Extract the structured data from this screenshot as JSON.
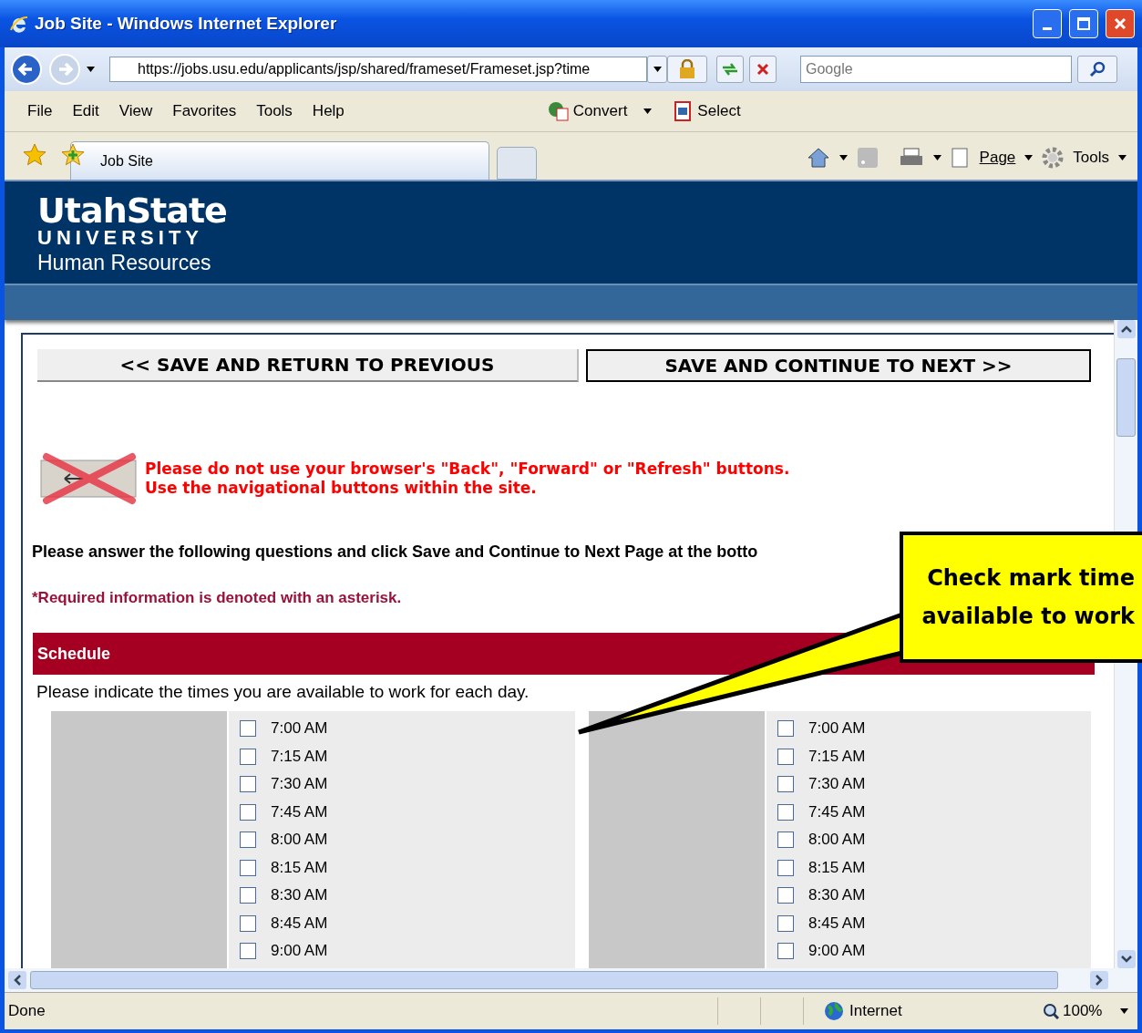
{
  "window": {
    "title": "Job Site - Windows Internet Explorer"
  },
  "address": {
    "url": "https://jobs.usu.edu/applicants/jsp/shared/frameset/Frameset.jsp?time"
  },
  "search": {
    "placeholder": "Google"
  },
  "menu": [
    "File",
    "Edit",
    "View",
    "Favorites",
    "Tools",
    "Help"
  ],
  "toolbar": [
    "Convert",
    "Select"
  ],
  "tab": {
    "label": "Job Site"
  },
  "commands": [
    "Page",
    "Tools"
  ],
  "header": {
    "logo_top": "UtahState",
    "logo_bottom": "UNIVERSITY",
    "subtitle": "Human Resources"
  },
  "buttons": [
    {
      "label": "<< SAVE AND RETURN TO PREVIOUS",
      "selected": false
    },
    {
      "label": "SAVE AND CONTINUE TO NEXT >>",
      "selected": true
    }
  ],
  "warning": [
    "Please do not use your browser's \"Back\", \"Forward\" or \"Refresh\" buttons.",
    "Use the navigational buttons within the site."
  ],
  "instructions": "Please answer the following questions and click Save and Continue to Next Page at the botto",
  "required_note": "*Required information is denoted with an asterisk.",
  "section": {
    "title": "Schedule",
    "prompt": "Please indicate the times you are available to work for each day."
  },
  "days": [
    {
      "times": [
        {
          "label": "7:00 AM",
          "checked": false
        },
        {
          "label": "7:15 AM",
          "checked": false
        },
        {
          "label": "7:30 AM",
          "checked": false
        },
        {
          "label": "7:45 AM",
          "checked": false
        },
        {
          "label": "8:00 AM",
          "checked": false
        },
        {
          "label": "8:15 AM",
          "checked": false
        },
        {
          "label": "8:30 AM",
          "checked": false
        },
        {
          "label": "8:45 AM",
          "checked": false
        },
        {
          "label": "9:00 AM",
          "checked": false
        }
      ]
    },
    {
      "times": [
        {
          "label": "7:00 AM",
          "checked": false
        },
        {
          "label": "7:15 AM",
          "checked": false
        },
        {
          "label": "7:30 AM",
          "checked": false
        },
        {
          "label": "7:45 AM",
          "checked": false
        },
        {
          "label": "8:00 AM",
          "checked": false
        },
        {
          "label": "8:15 AM",
          "checked": false
        },
        {
          "label": "8:30 AM",
          "checked": false
        },
        {
          "label": "8:45 AM",
          "checked": false
        },
        {
          "label": "9:00 AM",
          "checked": false
        }
      ]
    }
  ],
  "callout": [
    "Check mark time",
    "available to work"
  ],
  "status": {
    "text": "Done",
    "zone": "Internet",
    "zoom": "100%"
  }
}
